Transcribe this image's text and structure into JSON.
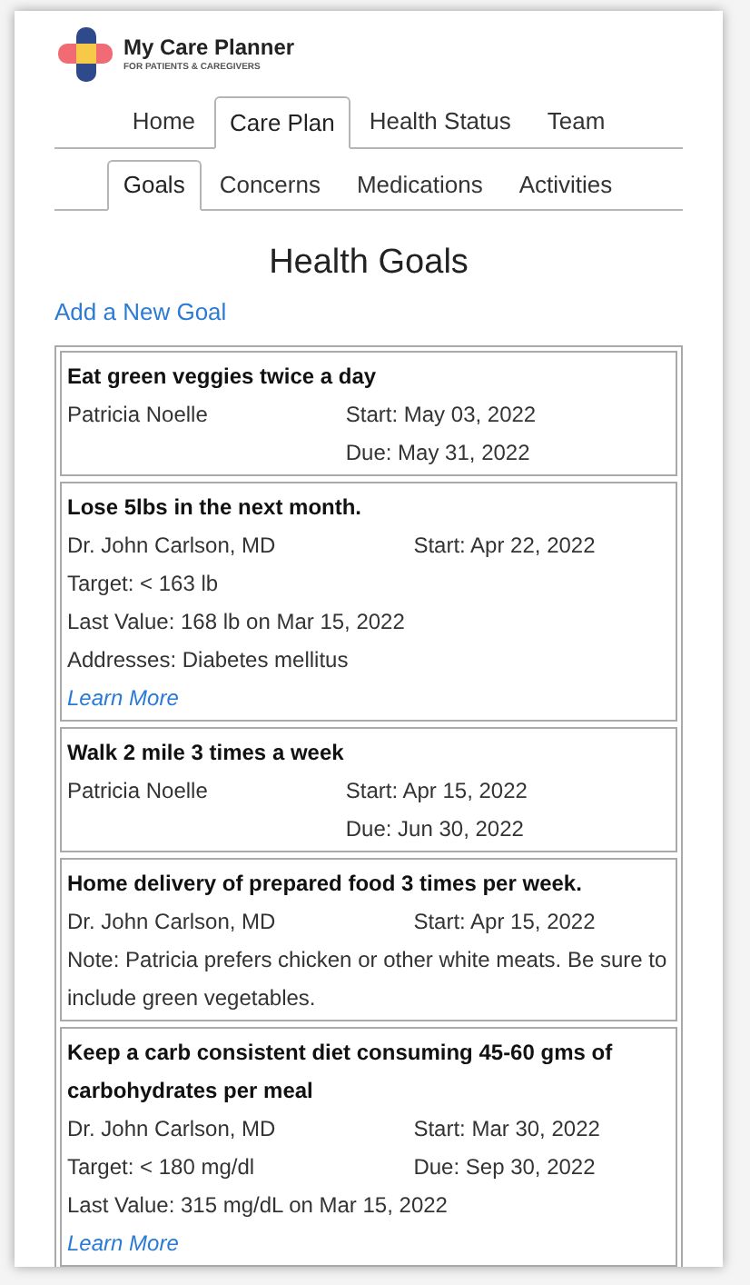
{
  "logo": {
    "title": "My Care Planner",
    "subtitle": "FOR PATIENTS & CAREGIVERS"
  },
  "tabs": [
    {
      "label": "Home",
      "selected": false
    },
    {
      "label": "Care Plan",
      "selected": true
    },
    {
      "label": "Health Status",
      "selected": false
    },
    {
      "label": "Team",
      "selected": false
    }
  ],
  "subtabs": [
    {
      "label": "Goals",
      "selected": true
    },
    {
      "label": "Concerns",
      "selected": false
    },
    {
      "label": "Medications",
      "selected": false
    },
    {
      "label": "Activities",
      "selected": false
    }
  ],
  "heading": "Health Goals",
  "add_link": "Add a New Goal",
  "goals": [
    {
      "title": "Eat green veggies twice a day",
      "rows": [
        {
          "left": "Patricia Noelle",
          "right": "Start: May 03, 2022"
        },
        {
          "right": "Due: May 31, 2022"
        }
      ]
    },
    {
      "title": "Lose 5lbs in the next month.",
      "rows": [
        {
          "left": "Dr. John Carlson, MD",
          "right": "Start: Apr 22, 2022"
        },
        {
          "text": "Target: < 163 lb"
        },
        {
          "text": "Last Value: 168 lb on Mar 15, 2022"
        },
        {
          "text": "Addresses: Diabetes mellitus"
        }
      ],
      "learn_more": "Learn More"
    },
    {
      "title": "Walk 2 mile 3 times a week",
      "rows": [
        {
          "left": "Patricia Noelle",
          "right": "Start: Apr 15, 2022"
        },
        {
          "right": "Due: Jun 30, 2022"
        }
      ]
    },
    {
      "title": "Home delivery of prepared food 3 times per week.",
      "rows": [
        {
          "left": "Dr. John Carlson, MD",
          "right": "Start: Apr 15, 2022"
        },
        {
          "text": "Note: Patricia prefers chicken or other white meats. Be sure to include green vegetables."
        }
      ]
    },
    {
      "title": "Keep a carb consistent diet consuming 45-60 gms of carbohydrates per meal",
      "rows": [
        {
          "left": "Dr. John Carlson, MD",
          "right": "Start: Mar 30, 2022"
        },
        {
          "left": "Target: < 180 mg/dl",
          "right": "Due: Sep 30, 2022"
        },
        {
          "text": "Last Value: 315 mg/dL on Mar 15, 2022"
        }
      ],
      "learn_more": "Learn More"
    }
  ]
}
